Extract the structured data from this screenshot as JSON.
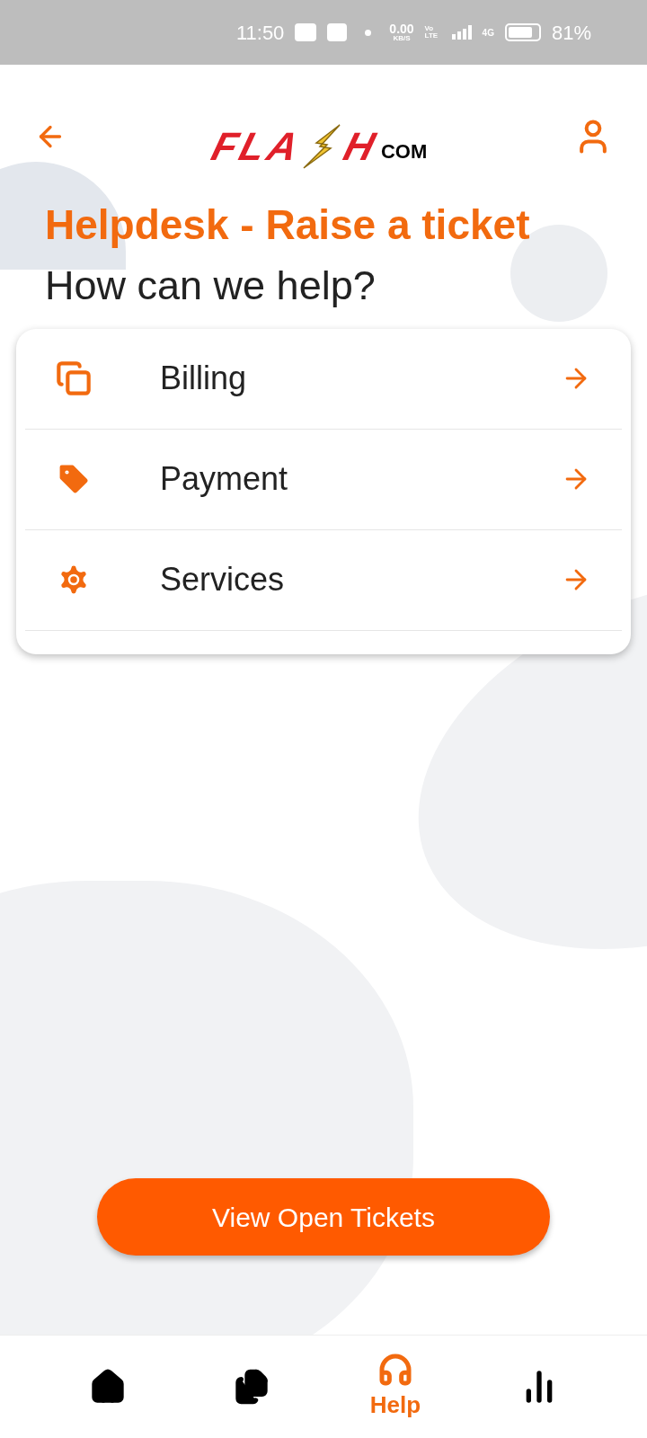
{
  "status_bar": {
    "time": "11:50",
    "speed": "0.00",
    "speed_unit": "KB/S",
    "volte": "Vo LTE",
    "network": "4G",
    "battery": "81%"
  },
  "header": {
    "logo": {
      "left": "FLA",
      "right": "H",
      "suffix": "COM"
    }
  },
  "title": "Helpdesk - Raise a ticket",
  "subtitle": "How can we help?",
  "categories": [
    {
      "kind": "copy",
      "label": "Billing"
    },
    {
      "kind": "tag",
      "label": "Payment"
    },
    {
      "kind": "gear",
      "label": "Services"
    }
  ],
  "primary_button": "View Open Tickets",
  "nav": [
    {
      "kind": "home",
      "selected": false
    },
    {
      "kind": "docs",
      "selected": false
    },
    {
      "kind": "headset",
      "label": "Help",
      "selected": true
    },
    {
      "kind": "chart",
      "selected": false
    }
  ]
}
